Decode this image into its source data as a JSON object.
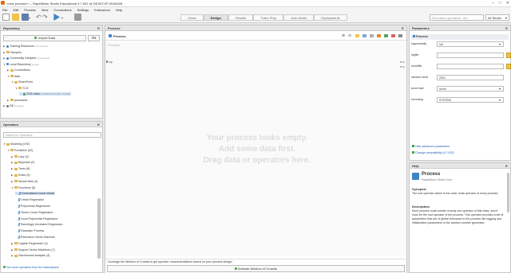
{
  "window": {
    "title": "<new process*> – RapidMiner Studio Educational 9.7.002 @ DESKTOP-I8VM328"
  },
  "menu": [
    "File",
    "Edit",
    "Process",
    "View",
    "Connections",
    "Settings",
    "Extensions",
    "Help"
  ],
  "views": [
    "Views",
    "Design",
    "Results",
    "Turbo Prep",
    "Auto Model",
    "Deployments"
  ],
  "active_view": "Design",
  "search": {
    "placeholder": "Find data, operators...etc"
  },
  "studio_dropdown": "All Studio",
  "repository": {
    "title": "Repository",
    "import_label": "Import Data",
    "items": [
      {
        "label": "Training Resources",
        "note": "(connected)",
        "depth": 0,
        "open": false,
        "kind": "res"
      },
      {
        "label": "Samples",
        "note": "",
        "depth": 0,
        "open": false,
        "kind": "folder"
      },
      {
        "label": "Community Samples",
        "note": "(connected)",
        "depth": 0,
        "open": false,
        "kind": "res"
      },
      {
        "label": "Local Repository",
        "note": "(Local)",
        "depth": 0,
        "open": true,
        "kind": "res"
      },
      {
        "label": "Connections",
        "note": "",
        "depth": 1,
        "open": false,
        "kind": "folder"
      },
      {
        "label": "data",
        "note": "",
        "depth": 1,
        "open": true,
        "kind": "folder"
      },
      {
        "label": "SharePoint",
        "note": "",
        "depth": 2,
        "open": true,
        "kind": "folder"
      },
      {
        "label": "TCG",
        "note": "",
        "depth": 3,
        "open": true,
        "kind": "folder"
      },
      {
        "label": "TCG Links",
        "note": "(3/12/20 10:07 AM – 13 kB)",
        "depth": 4,
        "open": false,
        "kind": "data",
        "selected": true
      },
      {
        "label": "processes",
        "note": "",
        "depth": 1,
        "open": false,
        "kind": "folder"
      },
      {
        "label": "DB",
        "note": "(Legacy)",
        "depth": 0,
        "open": false,
        "kind": "db"
      }
    ]
  },
  "operators": {
    "title": "Operators",
    "search_placeholder": "Search for Operators",
    "items": [
      {
        "label": "Modeling (190)",
        "depth": 0,
        "open": true,
        "kind": "folder"
      },
      {
        "label": "Predictive (62)",
        "depth": 1,
        "open": true,
        "kind": "folder"
      },
      {
        "label": "Lazy (2)",
        "depth": 2,
        "open": false,
        "kind": "folder"
      },
      {
        "label": "Bayesian (2)",
        "depth": 2,
        "open": false,
        "kind": "folder"
      },
      {
        "label": "Trees (8)",
        "depth": 2,
        "open": false,
        "kind": "folder"
      },
      {
        "label": "Rules (5)",
        "depth": 2,
        "open": false,
        "kind": "folder"
      },
      {
        "label": "Neural Nets (4)",
        "depth": 2,
        "open": false,
        "kind": "folder"
      },
      {
        "label": "Functions (8)",
        "depth": 2,
        "open": true,
        "kind": "folder"
      },
      {
        "label": "Generalized Linear Model",
        "depth": 3,
        "kind": "op",
        "selected": true
      },
      {
        "label": "Linear Regression",
        "depth": 3,
        "kind": "op"
      },
      {
        "label": "Polynomial Regression",
        "depth": 3,
        "kind": "op"
      },
      {
        "label": "Vector Linear Regression",
        "depth": 3,
        "kind": "op"
      },
      {
        "label": "Local Polynomial Regression",
        "depth": 3,
        "kind": "op"
      },
      {
        "label": "Seemingly Unrelated Regression",
        "depth": 3,
        "kind": "op"
      },
      {
        "label": "Gaussian Process",
        "depth": 3,
        "kind": "op"
      },
      {
        "label": "Relevance Vector Machine",
        "depth": 3,
        "kind": "op"
      },
      {
        "label": "Logistic Regression (3)",
        "depth": 2,
        "open": false,
        "kind": "folder"
      },
      {
        "label": "Support Vector Machines (7)",
        "depth": 2,
        "open": false,
        "kind": "folder"
      },
      {
        "label": "Discriminant Analysis (4)",
        "depth": 2,
        "open": false,
        "kind": "folder"
      }
    ],
    "marketplace_link": "Get more operators from the Marketplace"
  },
  "process": {
    "tab": "Process",
    "breadcrumb": "Process",
    "canvas_label": "Process",
    "port_label": "inp",
    "empty_lines": [
      "Your process looks empty.",
      "Add some data first.",
      "Drag data or operators here."
    ],
    "wisdom_hint": "Leverage the Wisdom of Crowds to get operator recommendations based on your process design!",
    "wisdom_button": "Activate Wisdom of Crowds"
  },
  "parameters": {
    "title": "Parameters",
    "subtitle": "Process",
    "rows": [
      {
        "label": "logverbosity",
        "value": "init",
        "kind": "select"
      },
      {
        "label": "logfile",
        "value": "",
        "kind": "file"
      },
      {
        "label": "resultfile",
        "value": "",
        "kind": "file"
      },
      {
        "label": "random seed",
        "value": "2001",
        "kind": "text"
      },
      {
        "label": "send mail",
        "value": "never",
        "kind": "select"
      },
      {
        "label": "encoding",
        "value": "SYSTEM",
        "kind": "select"
      }
    ],
    "hide_advanced": "Hide advanced parameters",
    "change_compat": "Change compatibility (9.7.002)"
  },
  "help": {
    "title": "Help",
    "op_name": "Process",
    "op_sub": "RapidMiner Studio Core",
    "synopsis_head": "Synopsis",
    "synopsis": "The root operator which is the outer most operator of every process.",
    "description_head": "Description",
    "description": "Each process must contain exactly one operator of this class, and it must be the root operator of the process. This operator provides a set of parameters that are of global relevance to the process like logging and initialization parameters of the random number generator."
  },
  "colors": {
    "accent_blue": "#3f84c7",
    "folder": "#e7b54a",
    "selection": "#cfe1f5",
    "link": "#1a5fb4"
  }
}
